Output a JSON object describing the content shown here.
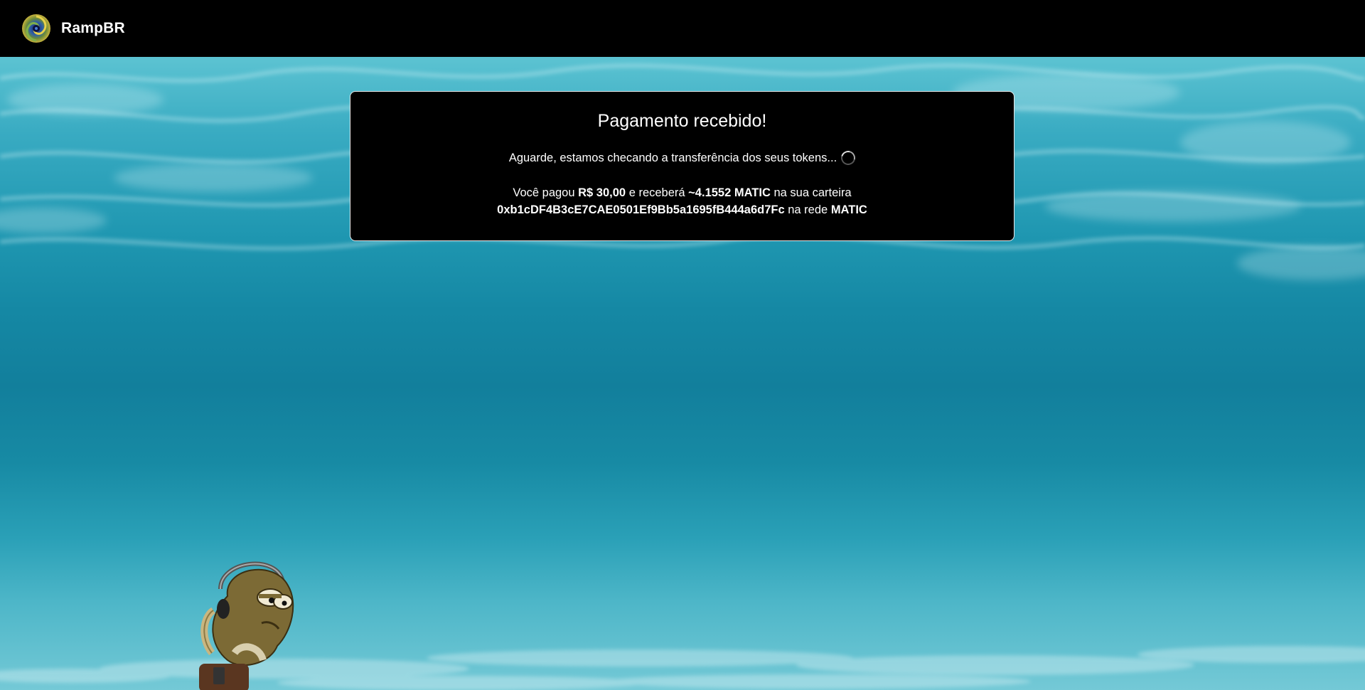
{
  "header": {
    "brand": "RampBR",
    "logo_icon": "swirl-logo-icon"
  },
  "card": {
    "title": "Pagamento recebido!",
    "status_text": "Aguarde, estamos checando a transferência dos seus tokens...",
    "status_icon": "loading-spinner-icon",
    "summary": {
      "prefix": "Você pagou",
      "amount_paid": "R$ 30,00",
      "mid_text": "e receberá",
      "amount_received": "~4.1552 MATIC",
      "wallet_text": "na sua carteira",
      "wallet_address": "0xb1cDF4B3cE7CAE0501Ef9Bb5a1695fB444a6d7Fc",
      "network_text": "na rede",
      "network": "MATIC"
    }
  },
  "colors": {
    "header_bg": "#000000",
    "card_bg": "#000000",
    "ocean": "#1588a4"
  }
}
